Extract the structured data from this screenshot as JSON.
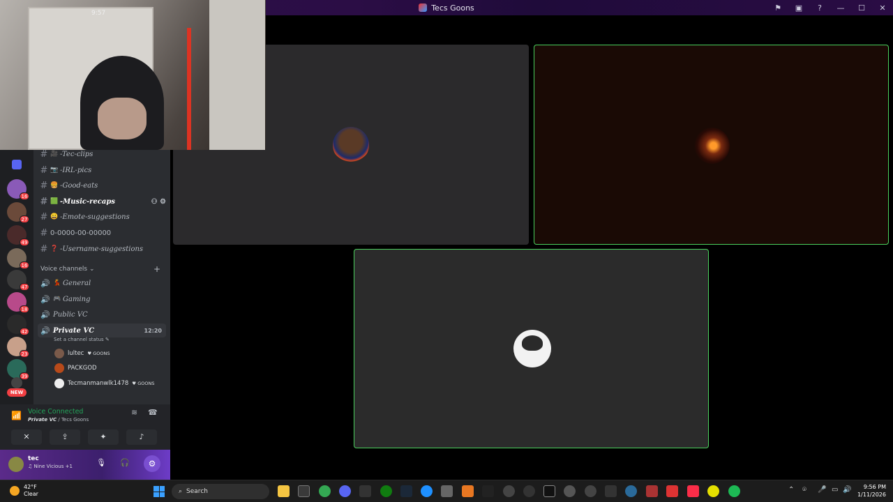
{
  "window": {
    "title": "Tecs Goons",
    "controls": [
      "⚑",
      "▣",
      "?",
      "—",
      "☐",
      "✕"
    ]
  },
  "webcam": {
    "clock": "9:57"
  },
  "channels": [
    {
      "name": "-Tec-clips",
      "emoji": "🎥",
      "active": false
    },
    {
      "name": "-IRL-pics",
      "emoji": "📷",
      "active": false
    },
    {
      "name": "-Good-eats",
      "emoji": "🍔",
      "active": false
    },
    {
      "name": "-Music-recaps",
      "emoji": "🟩",
      "active": true
    },
    {
      "name": "-Emote-suggestions",
      "emoji": "😀",
      "active": false
    },
    {
      "name": "\u0000-\u0000\u0000\u0000\u0000-\u0000\u0000-\u0000\u0000\u0000\u0000\u0000",
      "emoji": "",
      "active": false
    },
    {
      "name": "-Username-suggestions",
      "emoji": "❓",
      "active": false
    }
  ],
  "channel_row_6_text": "0-0000-00-00000",
  "voice_category": {
    "label": "Voice channels",
    "add": "+"
  },
  "voice_channels": [
    {
      "name": "General",
      "emoji": "💃"
    },
    {
      "name": "Gaming",
      "emoji": "🎮"
    },
    {
      "name": "Public VC",
      "emoji": ""
    }
  ],
  "active_voice": {
    "name": "Private VC",
    "time": "12:20",
    "status": "Set a channel status"
  },
  "members": [
    {
      "name": "lultec",
      "tag": "GOONS"
    },
    {
      "name": "PACKGOD",
      "tag": ""
    },
    {
      "name": "Tecmanmanwlk1478",
      "tag": "GOONS"
    }
  ],
  "guild_badges": [
    "16",
    "27",
    "49",
    "16",
    "47",
    "18",
    "42",
    "23",
    "39"
  ],
  "guild_new": "NEW",
  "voice_panel": {
    "status": "Voice Connected",
    "channel": "Private VC",
    "server": " / Tecs Goons"
  },
  "user": {
    "name": "tec",
    "activity": "♫ Nine Vicious +1"
  },
  "taskbar": {
    "temp": "42°F",
    "condition": "Clear",
    "search": "Search",
    "time": "9:56 PM",
    "date": "1/11/2026"
  },
  "colors": {
    "speaking": "#4ad25d",
    "voice_connected": "#23a55a",
    "notification": "#f23f43"
  }
}
